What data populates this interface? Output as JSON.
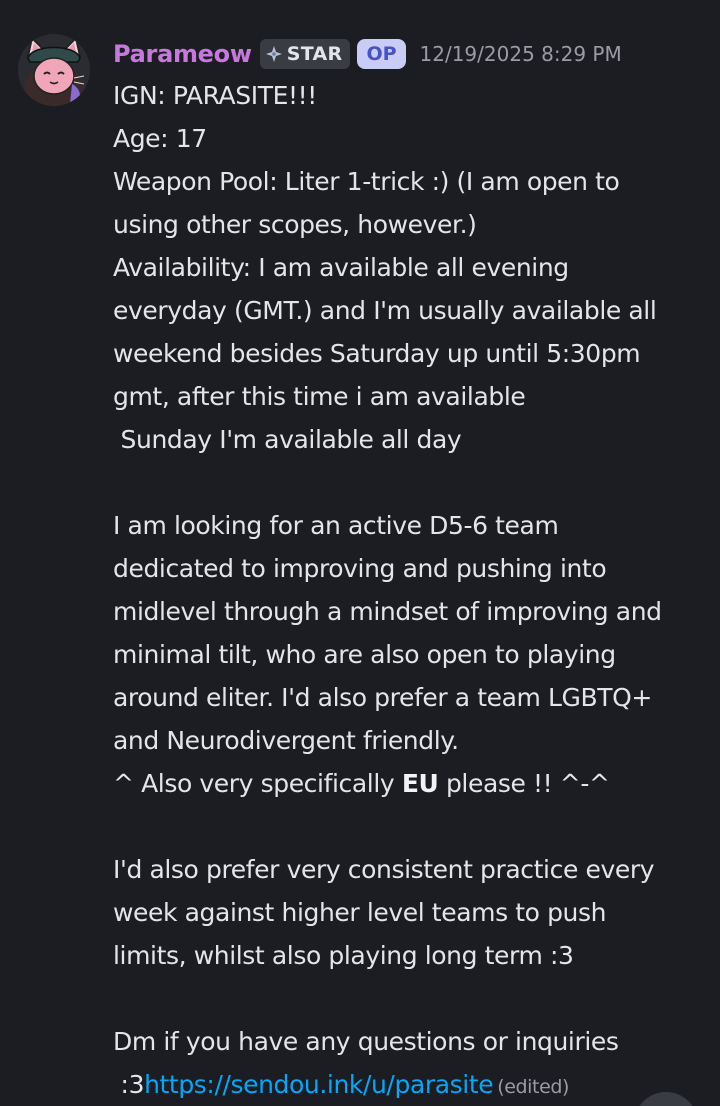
{
  "message": {
    "username": "Parameow",
    "tag_label": "STAR",
    "op_badge": "OP",
    "timestamp": "12/19/2025 8:29 PM",
    "colors": {
      "username": "#c778dd",
      "link": "#00a8fc",
      "op_badge_bg": "#c9cdf6",
      "op_badge_text": "#4752c4"
    },
    "lines": {
      "l1": "IGN: PARASITE!!!",
      "l2": "Age: 17",
      "l3": "Weapon Pool: Liter 1-trick :) (I am open to",
      "l4": "using other scopes, however.)",
      "l5": "Availability: I am available all evening",
      "l6": "everyday (GMT.) and I'm usually available all",
      "l7": "weekend besides Saturday up until 5:30pm",
      "l8": "gmt, after this time i am available",
      "l9": " Sunday I'm available all day",
      "l11": "I am looking for an active D5-6 team",
      "l12": "dedicated to improving and pushing into",
      "l13": "midlevel through a mindset of improving and",
      "l14": "minimal tilt, who are also open to playing",
      "l15": "around eliter. I'd also prefer a team LGBTQ+",
      "l16": "and Neurodivergent friendly.",
      "l17_pre": "^ Also very specifically ",
      "l17_bold": "EU",
      "l17_post": " please !! ^-^",
      "l19": "I'd also prefer very consistent practice every",
      "l20": "week against higher level teams to push",
      "l21": "limits, whilst also playing long term :3",
      "l23": "Dm if you have any questions or inquiries",
      "l24_pre": " :3",
      "l24_link": "https://sendou.ink/u/parasite",
      "edited": "(edited)"
    }
  }
}
